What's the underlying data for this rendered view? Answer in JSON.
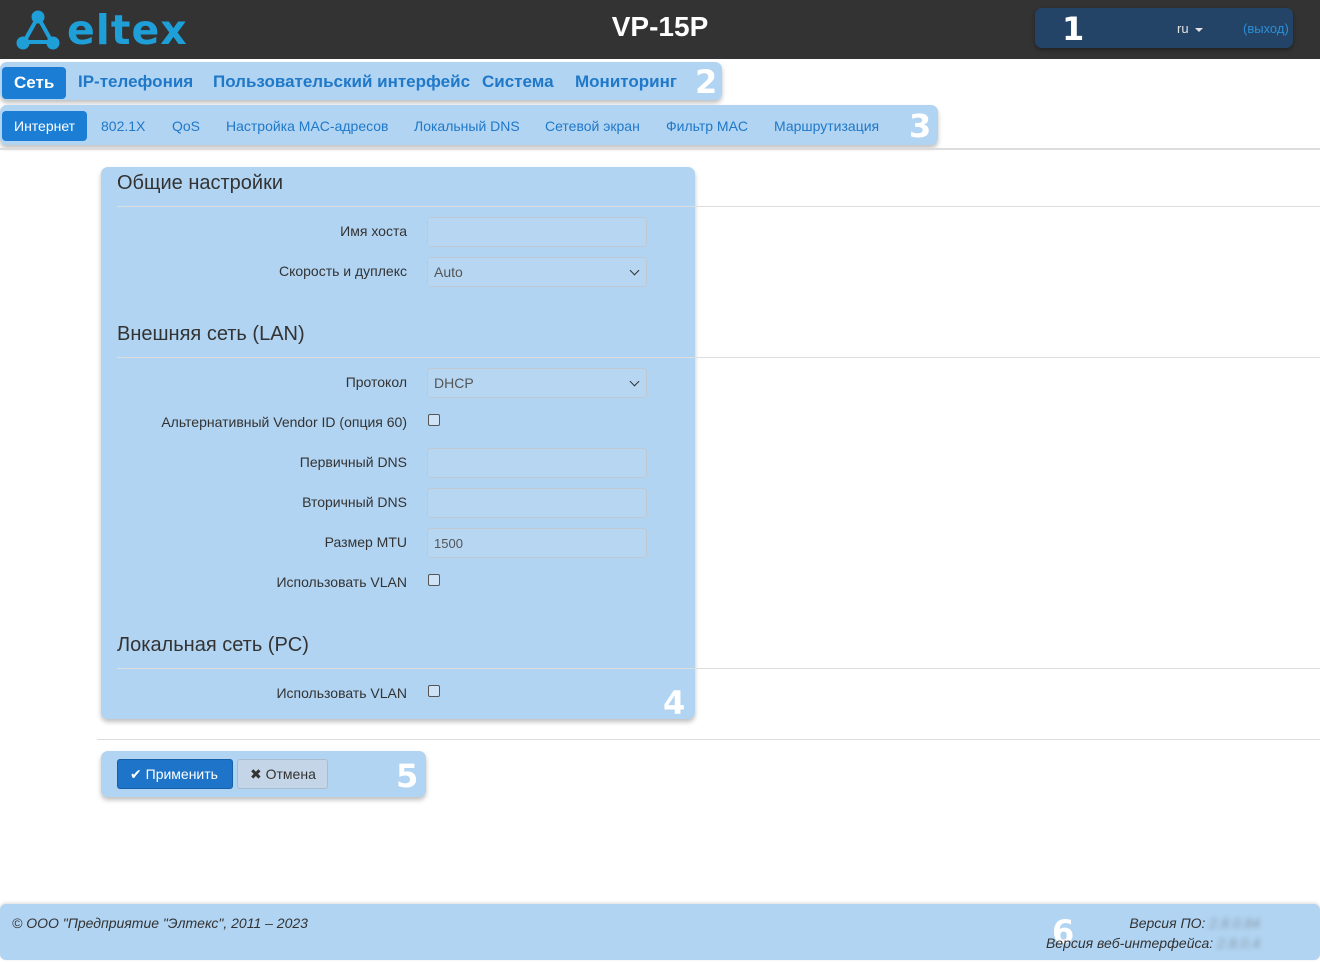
{
  "header": {
    "logo_text": "eltex",
    "device_name": "VP-15P",
    "language": "ru",
    "logout": "(выход)"
  },
  "callouts": [
    "1",
    "2",
    "3",
    "4",
    "5",
    "6"
  ],
  "main_nav": [
    {
      "label": "Сеть",
      "active": true
    },
    {
      "label": "IP-телефония"
    },
    {
      "label": "Пользовательский интерфейс"
    },
    {
      "label": "Система"
    },
    {
      "label": "Мониторинг"
    }
  ],
  "sub_nav": [
    {
      "label": "Интернет",
      "active": true
    },
    {
      "label": "802.1X"
    },
    {
      "label": "QoS"
    },
    {
      "label": "Настройка MAC-адресов"
    },
    {
      "label": "Локальный DNS"
    },
    {
      "label": "Сетевой экран"
    },
    {
      "label": "Фильтр MAC"
    },
    {
      "label": "Маршрутизация"
    }
  ],
  "form": {
    "general": {
      "title": "Общие настройки",
      "hostname_label": "Имя хоста",
      "hostname_value": "",
      "speed_label": "Скорость и дуплекс",
      "speed_value": "Auto"
    },
    "wan": {
      "title": "Внешняя сеть (LAN)",
      "protocol_label": "Протокол",
      "protocol_value": "DHCP",
      "vendor_id_label": "Альтернативный Vendor ID (опция 60)",
      "vendor_id_checked": false,
      "primary_dns_label": "Первичный DNS",
      "primary_dns_value": "",
      "secondary_dns_label": "Вторичный DNS",
      "secondary_dns_value": "",
      "mtu_label": "Размер MTU",
      "mtu_value": "1500",
      "vlan_label": "Использовать VLAN",
      "vlan_checked": false
    },
    "lan": {
      "title": "Локальная сеть (PC)",
      "vlan_label": "Использовать VLAN",
      "vlan_checked": false
    }
  },
  "actions": {
    "apply": "Применить",
    "cancel": "Отмена"
  },
  "footer": {
    "copyright": "© ООО \"Предприятие \"Элтекс\", 2011 – 2023",
    "fw_label": "Версия ПО:",
    "fw_value": "2.8.0.84",
    "web_label": "Версия веб-интерфейса:",
    "web_value": "2.8.0.4"
  },
  "colors": {
    "header_bg": "#333333",
    "accent": "#1b7dd3",
    "highlight": "#b1d4f2",
    "brand": "#1f9fd8"
  }
}
